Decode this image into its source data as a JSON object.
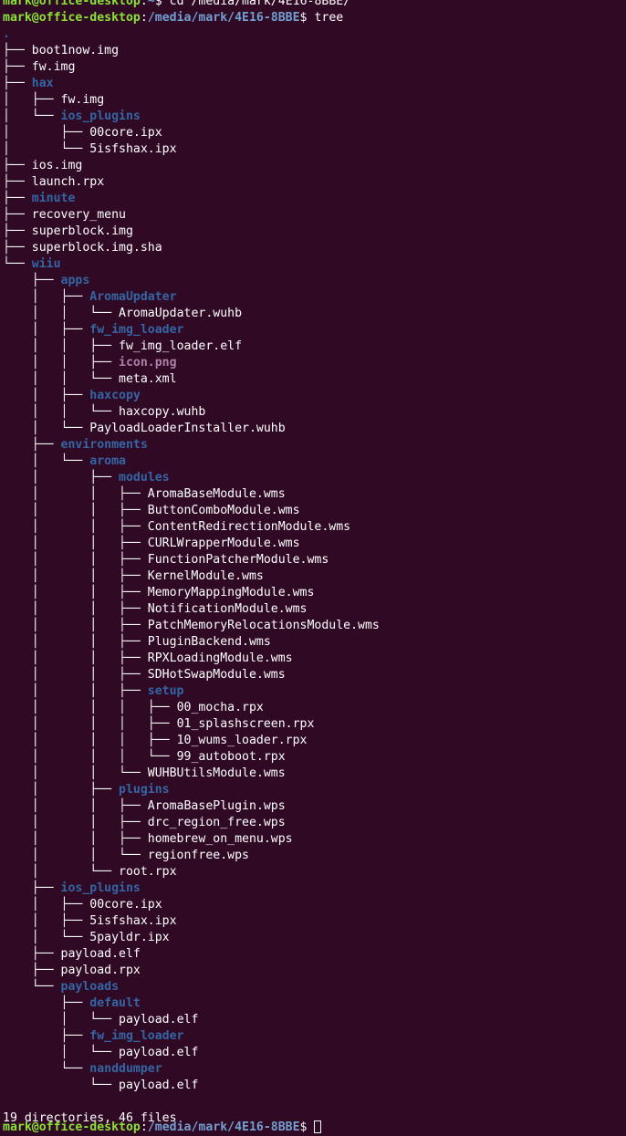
{
  "terminal": {
    "previous_command": {
      "user": "mark@office-desktop",
      "sep": ":",
      "path": "~",
      "dollar": "$ ",
      "command": "cd /media/mark/4E16-8BBE/"
    },
    "current_command": {
      "user": "mark@office-desktop",
      "sep": ":",
      "path": "/media/mark/4E16-8BBE",
      "dollar": "$ ",
      "command": "tree"
    },
    "tree_root": ".",
    "entries": [
      {
        "prefix": "├── ",
        "name": "boot1now.img",
        "kind": "file"
      },
      {
        "prefix": "├── ",
        "name": "fw.img",
        "kind": "file"
      },
      {
        "prefix": "├── ",
        "name": "hax",
        "kind": "dir"
      },
      {
        "prefix": "│   ├── ",
        "name": "fw.img",
        "kind": "file"
      },
      {
        "prefix": "│   └── ",
        "name": "ios_plugins",
        "kind": "dir"
      },
      {
        "prefix": "│       ├── ",
        "name": "00core.ipx",
        "kind": "file"
      },
      {
        "prefix": "│       └── ",
        "name": "5isfshax.ipx",
        "kind": "file"
      },
      {
        "prefix": "├── ",
        "name": "ios.img",
        "kind": "file"
      },
      {
        "prefix": "├── ",
        "name": "launch.rpx",
        "kind": "file"
      },
      {
        "prefix": "├── ",
        "name": "minute",
        "kind": "dir"
      },
      {
        "prefix": "├── ",
        "name": "recovery_menu",
        "kind": "file"
      },
      {
        "prefix": "├── ",
        "name": "superblock.img",
        "kind": "file"
      },
      {
        "prefix": "├── ",
        "name": "superblock.img.sha",
        "kind": "file"
      },
      {
        "prefix": "└── ",
        "name": "wiiu",
        "kind": "dir"
      },
      {
        "prefix": "    ├── ",
        "name": "apps",
        "kind": "dir"
      },
      {
        "prefix": "    │   ├── ",
        "name": "AromaUpdater",
        "kind": "dir"
      },
      {
        "prefix": "    │   │   └── ",
        "name": "AromaUpdater.wuhb",
        "kind": "file"
      },
      {
        "prefix": "    │   ├── ",
        "name": "fw_img_loader",
        "kind": "dir"
      },
      {
        "prefix": "    │   │   ├── ",
        "name": "fw_img_loader.elf",
        "kind": "file"
      },
      {
        "prefix": "    │   │   ├── ",
        "name": "icon.png",
        "kind": "image"
      },
      {
        "prefix": "    │   │   └── ",
        "name": "meta.xml",
        "kind": "file"
      },
      {
        "prefix": "    │   ├── ",
        "name": "haxcopy",
        "kind": "dir"
      },
      {
        "prefix": "    │   │   └── ",
        "name": "haxcopy.wuhb",
        "kind": "file"
      },
      {
        "prefix": "    │   └── ",
        "name": "PayloadLoaderInstaller.wuhb",
        "kind": "file"
      },
      {
        "prefix": "    ├── ",
        "name": "environments",
        "kind": "dir"
      },
      {
        "prefix": "    │   └── ",
        "name": "aroma",
        "kind": "dir"
      },
      {
        "prefix": "    │       ├── ",
        "name": "modules",
        "kind": "dir"
      },
      {
        "prefix": "    │       │   ├── ",
        "name": "AromaBaseModule.wms",
        "kind": "file"
      },
      {
        "prefix": "    │       │   ├── ",
        "name": "ButtonComboModule.wms",
        "kind": "file"
      },
      {
        "prefix": "    │       │   ├── ",
        "name": "ContentRedirectionModule.wms",
        "kind": "file"
      },
      {
        "prefix": "    │       │   ├── ",
        "name": "CURLWrapperModule.wms",
        "kind": "file"
      },
      {
        "prefix": "    │       │   ├── ",
        "name": "FunctionPatcherModule.wms",
        "kind": "file"
      },
      {
        "prefix": "    │       │   ├── ",
        "name": "KernelModule.wms",
        "kind": "file"
      },
      {
        "prefix": "    │       │   ├── ",
        "name": "MemoryMappingModule.wms",
        "kind": "file"
      },
      {
        "prefix": "    │       │   ├── ",
        "name": "NotificationModule.wms",
        "kind": "file"
      },
      {
        "prefix": "    │       │   ├── ",
        "name": "PatchMemoryRelocationsModule.wms",
        "kind": "file"
      },
      {
        "prefix": "    │       │   ├── ",
        "name": "PluginBackend.wms",
        "kind": "file"
      },
      {
        "prefix": "    │       │   ├── ",
        "name": "RPXLoadingModule.wms",
        "kind": "file"
      },
      {
        "prefix": "    │       │   ├── ",
        "name": "SDHotSwapModule.wms",
        "kind": "file"
      },
      {
        "prefix": "    │       │   ├── ",
        "name": "setup",
        "kind": "dir"
      },
      {
        "prefix": "    │       │   │   ├── ",
        "name": "00_mocha.rpx",
        "kind": "file"
      },
      {
        "prefix": "    │       │   │   ├── ",
        "name": "01_splashscreen.rpx",
        "kind": "file"
      },
      {
        "prefix": "    │       │   │   ├── ",
        "name": "10_wums_loader.rpx",
        "kind": "file"
      },
      {
        "prefix": "    │       │   │   └── ",
        "name": "99_autoboot.rpx",
        "kind": "file"
      },
      {
        "prefix": "    │       │   └── ",
        "name": "WUHBUtilsModule.wms",
        "kind": "file"
      },
      {
        "prefix": "    │       ├── ",
        "name": "plugins",
        "kind": "dir"
      },
      {
        "prefix": "    │       │   ├── ",
        "name": "AromaBasePlugin.wps",
        "kind": "file"
      },
      {
        "prefix": "    │       │   ├── ",
        "name": "drc_region_free.wps",
        "kind": "file"
      },
      {
        "prefix": "    │       │   ├── ",
        "name": "homebrew_on_menu.wps",
        "kind": "file"
      },
      {
        "prefix": "    │       │   └── ",
        "name": "regionfree.wps",
        "kind": "file"
      },
      {
        "prefix": "    │       └── ",
        "name": "root.rpx",
        "kind": "file"
      },
      {
        "prefix": "    ├── ",
        "name": "ios_plugins",
        "kind": "dir"
      },
      {
        "prefix": "    │   ├── ",
        "name": "00core.ipx",
        "kind": "file"
      },
      {
        "prefix": "    │   ├── ",
        "name": "5isfshax.ipx",
        "kind": "file"
      },
      {
        "prefix": "    │   └── ",
        "name": "5payldr.ipx",
        "kind": "file"
      },
      {
        "prefix": "    ├── ",
        "name": "payload.elf",
        "kind": "file"
      },
      {
        "prefix": "    ├── ",
        "name": "payload.rpx",
        "kind": "file"
      },
      {
        "prefix": "    └── ",
        "name": "payloads",
        "kind": "dir"
      },
      {
        "prefix": "        ├── ",
        "name": "default",
        "kind": "dir"
      },
      {
        "prefix": "        │   └── ",
        "name": "payload.elf",
        "kind": "file"
      },
      {
        "prefix": "        ├── ",
        "name": "fw_img_loader",
        "kind": "dir"
      },
      {
        "prefix": "        │   └── ",
        "name": "payload.elf",
        "kind": "file"
      },
      {
        "prefix": "        └── ",
        "name": "nanddumper",
        "kind": "dir"
      },
      {
        "prefix": "            └── ",
        "name": "payload.elf",
        "kind": "file"
      }
    ],
    "summary": "19 directories, 46 files",
    "next_prompt": {
      "user": "mark@office-desktop",
      "sep": ":",
      "path": "/media/mark/4E16-8BBE",
      "dollar": "$ "
    },
    "colors": {
      "background": "#300a24",
      "prompt_user": "#8ae234",
      "prompt_path": "#729fcf",
      "directory": "#3465a4",
      "image_file": "#ad7fa8",
      "text": "#ffffff"
    }
  }
}
